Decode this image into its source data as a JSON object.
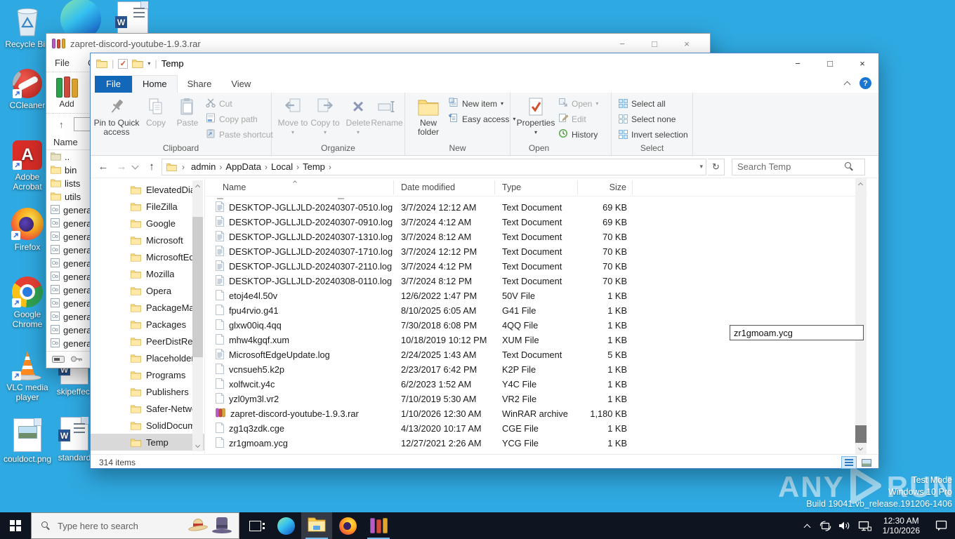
{
  "desktop": {
    "icons": {
      "recycle_bin": "Recycle Bin",
      "ccleaner": "CCleaner",
      "adobe": "Adobe Acrobat",
      "firefox": "Firefox",
      "chrome": "Google Chrome",
      "vlc": "VLC media player",
      "couldoct": "couldoct.png",
      "skipeffect": "skipeffect",
      "standard": "standard"
    },
    "watermark": {
      "left": "ANY",
      "right": "RUN"
    },
    "test_mode": {
      "line1": "Test Mode",
      "line2": "Windows 10 Pro",
      "line3": "Build 19041.vb_release.191206-1406"
    }
  },
  "winrar": {
    "title": "zapret-discord-youtube-1.9.3.rar",
    "menu": [
      "File",
      "Commands"
    ],
    "add_label": "Add",
    "column": "Name",
    "items": [
      {
        "label": "..",
        "icon": "up-folder"
      },
      {
        "label": "bin",
        "icon": "folder"
      },
      {
        "label": "lists",
        "icon": "folder"
      },
      {
        "label": "utils",
        "icon": "folder"
      },
      {
        "label": "general",
        "icon": "gen"
      },
      {
        "label": "general",
        "icon": "gen"
      },
      {
        "label": "general",
        "icon": "gen"
      },
      {
        "label": "general",
        "icon": "gen"
      },
      {
        "label": "general",
        "icon": "gen"
      },
      {
        "label": "general",
        "icon": "gen"
      },
      {
        "label": "general",
        "icon": "gen"
      },
      {
        "label": "general",
        "icon": "gen"
      },
      {
        "label": "general",
        "icon": "gen"
      },
      {
        "label": "general",
        "icon": "gen"
      },
      {
        "label": "general",
        "icon": "gen"
      }
    ]
  },
  "explorer": {
    "title": "Temp",
    "tabs": [
      "File",
      "Home",
      "Share",
      "View"
    ],
    "ribbon": {
      "clipboard": {
        "label": "Clipboard",
        "pin": "Pin to Quick access",
        "copy": "Copy",
        "paste": "Paste",
        "cut": "Cut",
        "copy_path": "Copy path",
        "paste_shortcut": "Paste shortcut"
      },
      "organize": {
        "label": "Organize",
        "move_to": "Move to",
        "copy_to": "Copy to",
        "del": "Delete",
        "rename": "Rename"
      },
      "newgrp": {
        "label": "New",
        "new_folder": "New folder",
        "new_item": "New item",
        "easy_access": "Easy access"
      },
      "open": {
        "label": "Open",
        "properties": "Properties",
        "open": "Open",
        "edit": "Edit",
        "history": "History"
      },
      "select": {
        "label": "Select",
        "all": "Select all",
        "none": "Select none",
        "invert": "Invert selection"
      }
    },
    "address": {
      "crumbs": [
        "admin",
        "AppData",
        "Local",
        "Temp"
      ]
    },
    "search_placeholder": "Search Temp",
    "tree": [
      "ElevatedDia",
      "FileZilla",
      "Google",
      "Microsoft",
      "MicrosoftEd",
      "Mozilla",
      "Opera",
      "PackageMa",
      "Packages",
      "PeerDistRep",
      "Placeholder",
      "Programs",
      "Publishers",
      "Safer-Netwo",
      "SolidDocum",
      "Temp"
    ],
    "tree_selected": "Temp",
    "columns": [
      "Name",
      "Date modified",
      "Type",
      "Size"
    ],
    "files": [
      {
        "name": "DESKTOP-JGLLJLD-20240307-0510.log",
        "date": "3/7/2024 12:12 AM",
        "type": "Text Document",
        "size": "69 KB",
        "icon": "log"
      },
      {
        "name": "DESKTOP-JGLLJLD-20240307-0910.log",
        "date": "3/7/2024 4:12 AM",
        "type": "Text Document",
        "size": "69 KB",
        "icon": "log"
      },
      {
        "name": "DESKTOP-JGLLJLD-20240307-1310.log",
        "date": "3/7/2024 8:12 AM",
        "type": "Text Document",
        "size": "70 KB",
        "icon": "log"
      },
      {
        "name": "DESKTOP-JGLLJLD-20240307-1710.log",
        "date": "3/7/2024 12:12 PM",
        "type": "Text Document",
        "size": "70 KB",
        "icon": "log"
      },
      {
        "name": "DESKTOP-JGLLJLD-20240307-2110.log",
        "date": "3/7/2024 4:12 PM",
        "type": "Text Document",
        "size": "70 KB",
        "icon": "log"
      },
      {
        "name": "DESKTOP-JGLLJLD-20240308-0110.log",
        "date": "3/7/2024 8:12 PM",
        "type": "Text Document",
        "size": "70 KB",
        "icon": "log"
      },
      {
        "name": "etoj4e4l.50v",
        "date": "12/6/2022 1:47 PM",
        "type": "50V File",
        "size": "1 KB",
        "icon": "file"
      },
      {
        "name": "fpu4rvio.g41",
        "date": "8/10/2025 6:05 AM",
        "type": "G41 File",
        "size": "1 KB",
        "icon": "file"
      },
      {
        "name": "glxw00iq.4qq",
        "date": "7/30/2018 6:08 PM",
        "type": "4QQ File",
        "size": "1 KB",
        "icon": "file"
      },
      {
        "name": "mhw4kgqf.xum",
        "date": "10/18/2019 10:12 PM",
        "type": "XUM File",
        "size": "1 KB",
        "icon": "file"
      },
      {
        "name": "MicrosoftEdgeUpdate.log",
        "date": "2/24/2025 1:43 AM",
        "type": "Text Document",
        "size": "5 KB",
        "icon": "log"
      },
      {
        "name": "vcnsueh5.k2p",
        "date": "2/23/2017 6:42 PM",
        "type": "K2P File",
        "size": "1 KB",
        "icon": "file"
      },
      {
        "name": "xolfwcit.y4c",
        "date": "6/2/2023 1:52 AM",
        "type": "Y4C File",
        "size": "1 KB",
        "icon": "file"
      },
      {
        "name": "yzl0ym3l.vr2",
        "date": "7/10/2019 5:30 AM",
        "type": "VR2 File",
        "size": "1 KB",
        "icon": "file"
      },
      {
        "name": "zapret-discord-youtube-1.9.3.rar",
        "date": "1/10/2026 12:30 AM",
        "type": "WinRAR archive",
        "size": "1,180 KB",
        "icon": "rar"
      },
      {
        "name": "zg1q3zdk.cge",
        "date": "4/13/2020 10:17 AM",
        "type": "CGE File",
        "size": "1 KB",
        "icon": "file"
      },
      {
        "name": "zr1gmoam.ycg",
        "date": "12/27/2021 2:26 AM",
        "type": "YCG File",
        "size": "1 KB",
        "icon": "file"
      }
    ],
    "rename_value": "zr1gmoam.ycg",
    "status": "314 items"
  },
  "taskbar": {
    "search_placeholder": "Type here to search",
    "time": "12:30 AM",
    "date": "1/10/2026"
  }
}
